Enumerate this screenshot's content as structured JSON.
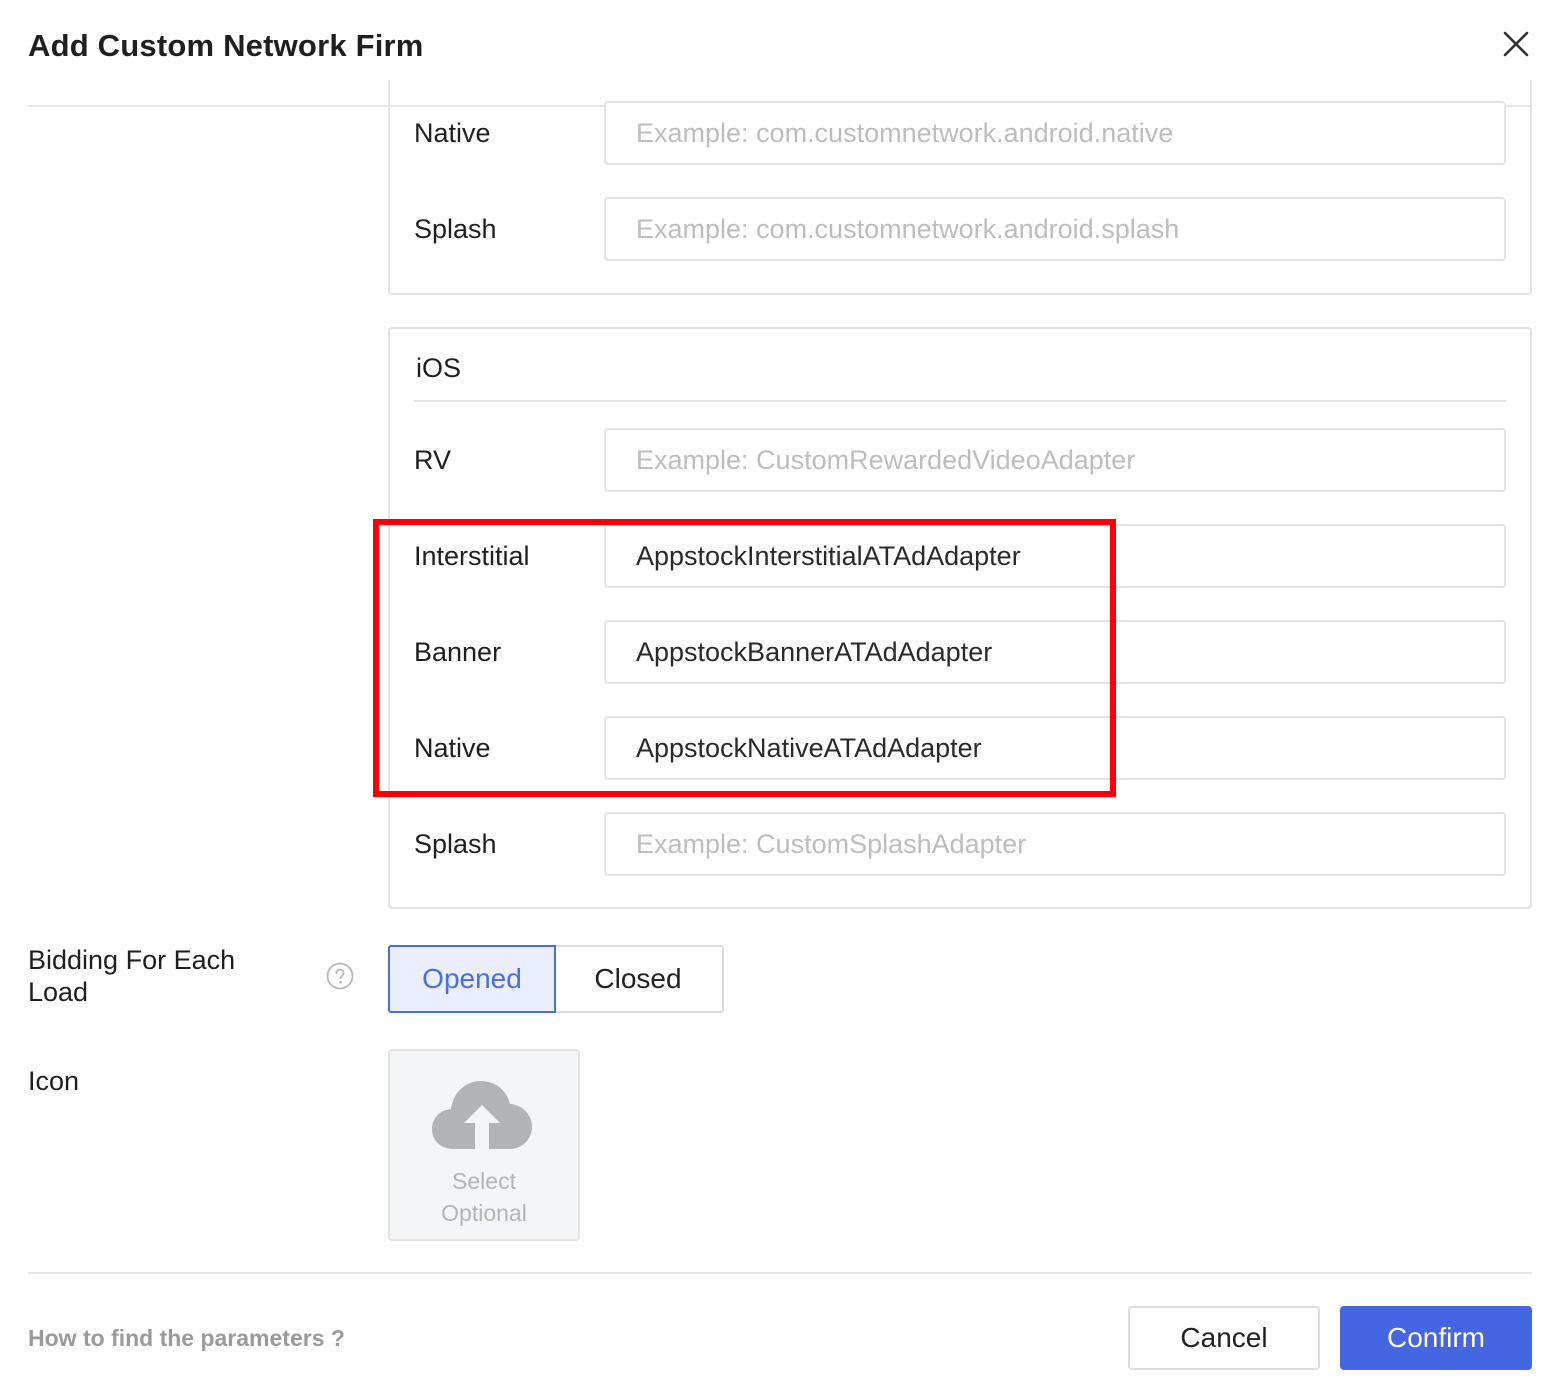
{
  "dialog": {
    "title": "Add Custom Network Firm",
    "close_icon": "close-icon"
  },
  "android": {
    "rows": [
      {
        "label": "Native",
        "value": "",
        "placeholder": "Example: com.customnetwork.android.native"
      },
      {
        "label": "Splash",
        "value": "",
        "placeholder": "Example: com.customnetwork.android.splash"
      }
    ]
  },
  "ios": {
    "title": "iOS",
    "rows": [
      {
        "label": "RV",
        "value": "",
        "placeholder": "Example: CustomRewardedVideoAdapter"
      },
      {
        "label": "Interstitial",
        "value": "AppstockInterstitialATAdAdapter",
        "placeholder": ""
      },
      {
        "label": "Banner",
        "value": "AppstockBannerATAdAdapter",
        "placeholder": ""
      },
      {
        "label": "Native",
        "value": "AppstockNativeATAdAdapter",
        "placeholder": ""
      },
      {
        "label": "Splash",
        "value": "",
        "placeholder": "Example: CustomSplashAdapter"
      }
    ]
  },
  "bidding": {
    "label": "Bidding For Each Load",
    "options": [
      "Opened",
      "Closed"
    ],
    "selected": "Opened"
  },
  "icon_upload": {
    "label": "Icon",
    "line1": "Select",
    "line2": "Optional"
  },
  "footer": {
    "help_link": "How to find the parameters ?",
    "cancel_label": "Cancel",
    "confirm_label": "Confirm"
  },
  "colors": {
    "primary": "#4466e2",
    "highlight": "#fb0006",
    "selected_bg": "#eaeeff"
  }
}
